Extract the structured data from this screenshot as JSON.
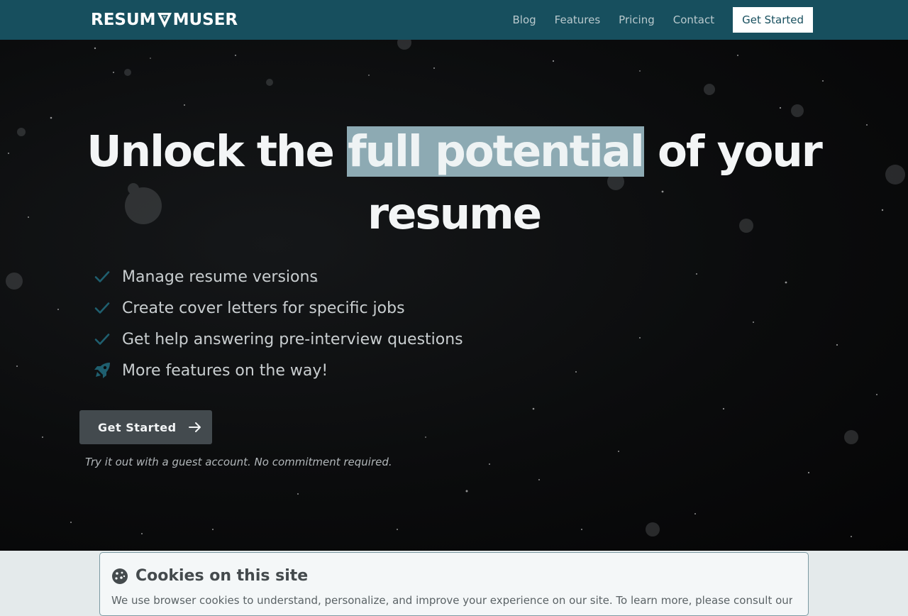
{
  "nav": {
    "logo_text_left": "RESUM",
    "logo_text_right": "MUSER",
    "links": [
      {
        "label": "Blog"
      },
      {
        "label": "Features"
      },
      {
        "label": "Pricing"
      },
      {
        "label": "Contact"
      }
    ],
    "cta_label": "Get Started"
  },
  "hero": {
    "headline_before": "Unlock the ",
    "headline_highlight": "full potential",
    "headline_after": " of your resume",
    "features": [
      {
        "icon": "check-icon",
        "text": "Manage resume versions"
      },
      {
        "icon": "check-icon",
        "text": "Create cover letters for specific jobs"
      },
      {
        "icon": "check-icon",
        "text": "Get help answering pre-interview questions"
      },
      {
        "icon": "rocket-icon",
        "text": "More features on the way!"
      }
    ],
    "cta_label": "Get Started",
    "note": "Try it out with a guest account. No commitment required."
  },
  "cookie": {
    "title": "Cookies on this site",
    "text": "We use browser cookies to understand, personalize, and improve your experience on our site. To learn more, please consult our"
  },
  "colors": {
    "nav_bg": "#174f5e",
    "highlight": "#8daab3",
    "check": "#1f5f6f",
    "cta_bg": "#434a4e"
  }
}
